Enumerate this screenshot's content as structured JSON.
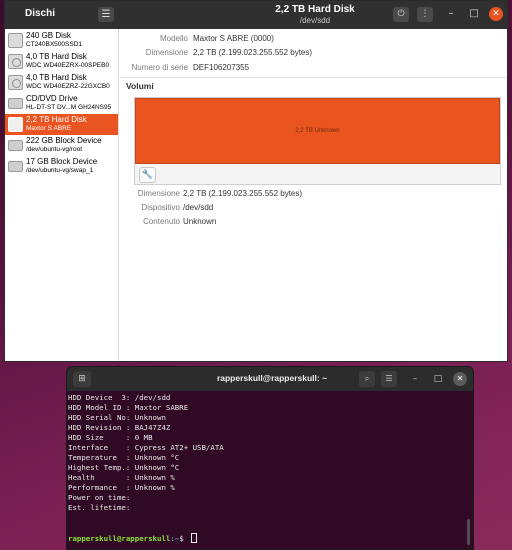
{
  "disks_window": {
    "app_title": "Dischi",
    "header_title": "2,2 TB Hard Disk",
    "header_subtitle": "/dev/sdd",
    "menu_icon": "hamburger-icon",
    "power_icon": "power-icon",
    "more_icon": "kebab-icon",
    "accent": "#e95420",
    "disks": [
      {
        "name": "240 GB Disk",
        "model": "CT240BX500SSD1",
        "icon": "ssd-icon"
      },
      {
        "name": "4,0 TB Hard Disk",
        "model": "WDC WD40EZRX-00SPEB0",
        "icon": "hard-disk-icon"
      },
      {
        "name": "4,0 TB Hard Disk",
        "model": "WDC WD40EZRZ-22GXCB0",
        "icon": "hard-disk-icon"
      },
      {
        "name": "CD/DVD Drive",
        "model": "HL-DT-ST DV...M GH24NS95",
        "icon": "optical-drive-icon"
      },
      {
        "name": "2,2 TB Hard Disk",
        "model": "Maxtor S ABRE",
        "icon": "usb-disk-icon",
        "selected": true
      },
      {
        "name": "222 GB Block Device",
        "model": "/dev/ubuntu-vg/root",
        "icon": "block-device-icon"
      },
      {
        "name": "17 GB Block Device",
        "model": "/dev/ubuntu-vg/swap_1",
        "icon": "block-device-icon"
      }
    ],
    "details": [
      {
        "key": "Modello",
        "value": "Maxtor S ABRE (0000)"
      },
      {
        "key": "Dimensione",
        "value": "2,2 TB (2.199.023.255.552 bytes)"
      },
      {
        "key": "Numero di serie",
        "value": "DEF106207355"
      }
    ],
    "volumes_heading": "Volumi",
    "volume_label": "2,2 TB Unknown",
    "volume_tool_icon": "wrench-icon",
    "volume_details": [
      {
        "key": "Dimensione",
        "value": "2,2 TB (2.199.023.255.552 bytes)"
      },
      {
        "key": "Dispositivo",
        "value": "/dev/sdd"
      },
      {
        "key": "Contenuto",
        "value": "Unknown"
      }
    ]
  },
  "terminal_window": {
    "title": "rapperskull@rapperskull: ~",
    "bg_color": "#300a24",
    "lines": [
      "HDD Device  3: /dev/sdd",
      "HDD Model ID : Maxtor SABRE",
      "HDD Serial No: Unknown",
      "HDD Revision : BAJ47Z4Z",
      "HDD Size     : 0 MB",
      "Interface    : Cypress AT2+ USB/ATA",
      "Temperature  : Unknown °C",
      "Highest Temp.: Unknown °C",
      "Health       : Unknown %",
      "Performance  : Unknown %",
      "Power on time:",
      "Est. lifetime:"
    ],
    "prompt_user": "rapperskull@rapperskull",
    "prompt_path": ":~",
    "prompt_symbol": "$ "
  }
}
